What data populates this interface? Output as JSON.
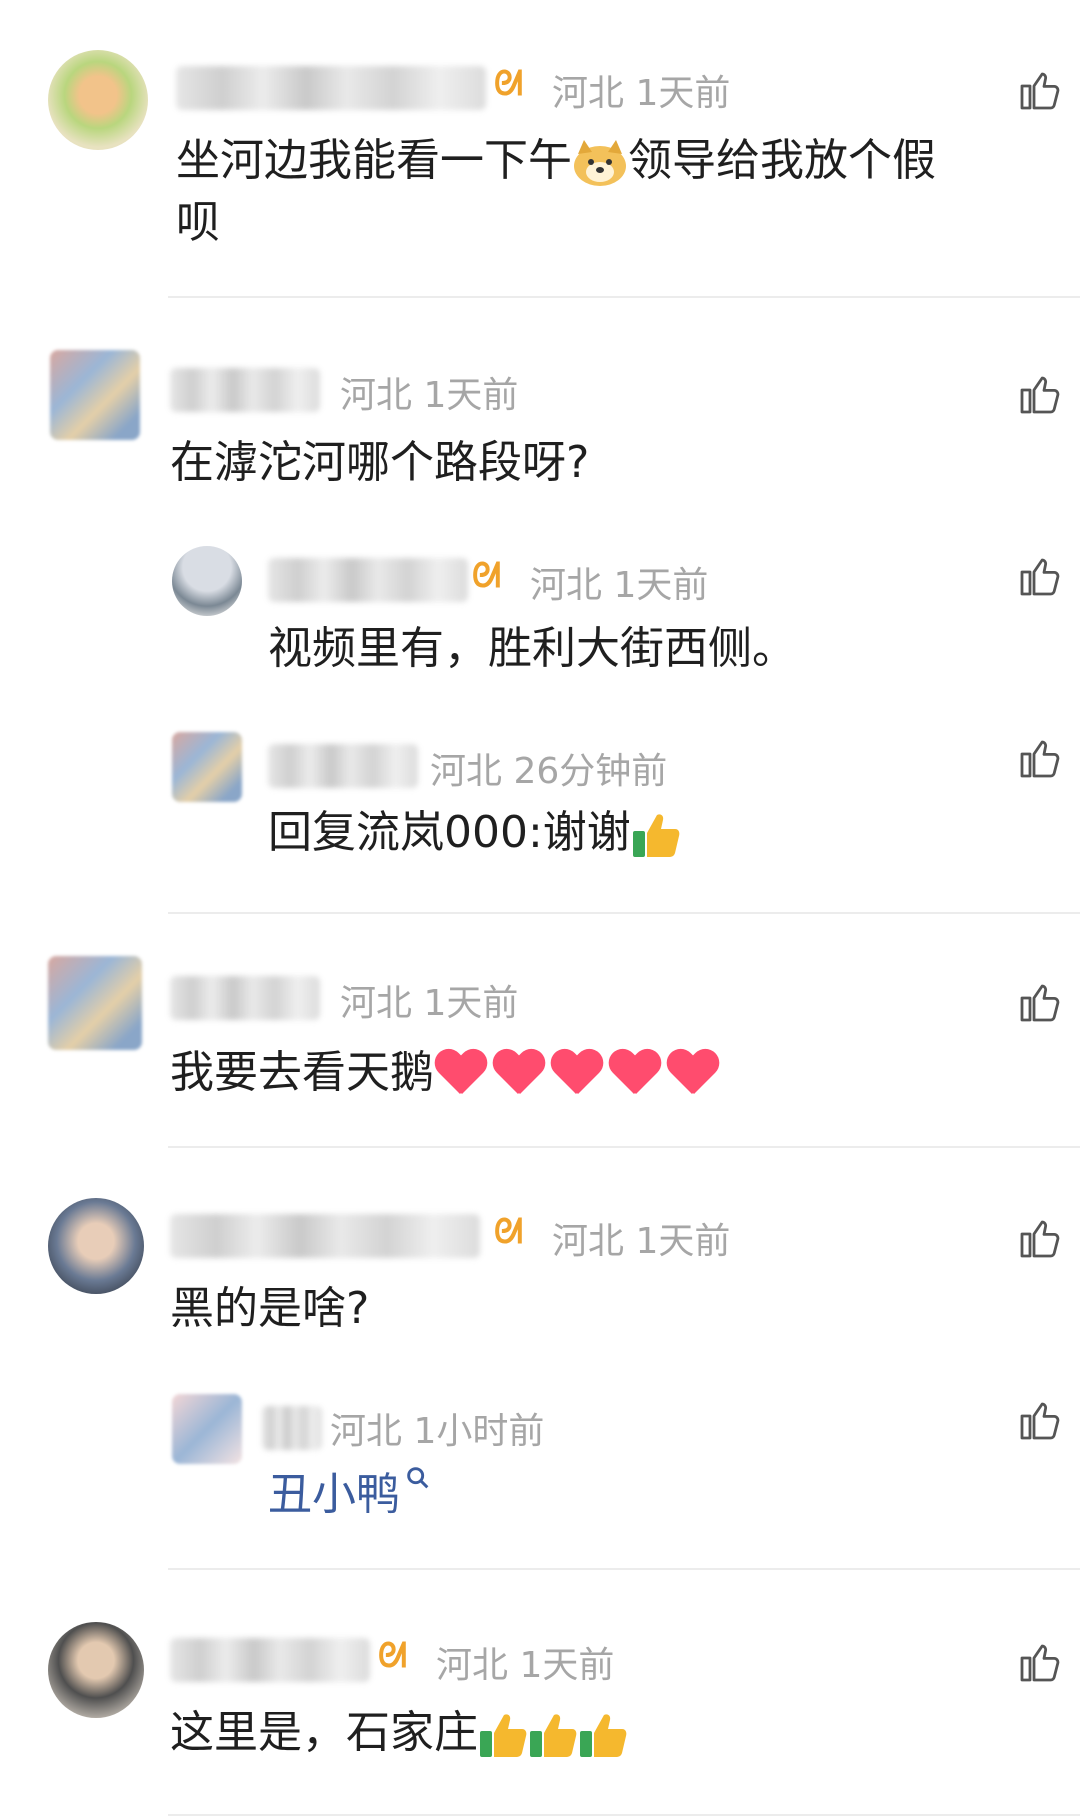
{
  "comments": [
    {
      "id": "c1",
      "location": "河北",
      "time": "1天前",
      "text_a": "坐河边我能看一下午",
      "text_b": "领导给我放个假",
      "text_c": "呗"
    },
    {
      "id": "c2",
      "location": "河北",
      "time": "1天前",
      "text": "在滹沱河哪个路段呀?"
    },
    {
      "id": "c2r1",
      "location": "河北",
      "time": "1天前",
      "text": "视频里有，胜利大街西侧。"
    },
    {
      "id": "c2r2",
      "location": "河北",
      "time": "26分钟前",
      "reply_prefix": "回复",
      "reply_name": "流岚000",
      "reply_text": ":谢谢"
    },
    {
      "id": "c3",
      "location": "河北",
      "time": "1天前",
      "text": "我要去看天鹅"
    },
    {
      "id": "c4",
      "location": "河北",
      "time": "1天前",
      "text": "黑的是啥?"
    },
    {
      "id": "c4r1",
      "location": "河北",
      "time": "1小时前",
      "text": "丑小鸭"
    },
    {
      "id": "c5",
      "location": "河北",
      "time": "1天前",
      "text": "这里是，石家庄"
    }
  ],
  "icons": {
    "like": "thumbs-up-outline-icon",
    "vip": "vip-badge-icon",
    "search": "search-icon"
  },
  "colors": {
    "meta": "#a6a6a6",
    "text": "#1f1f1f",
    "link": "#3b5c9e",
    "heart": "#ff4c6e",
    "vip": "#f0a22b"
  }
}
